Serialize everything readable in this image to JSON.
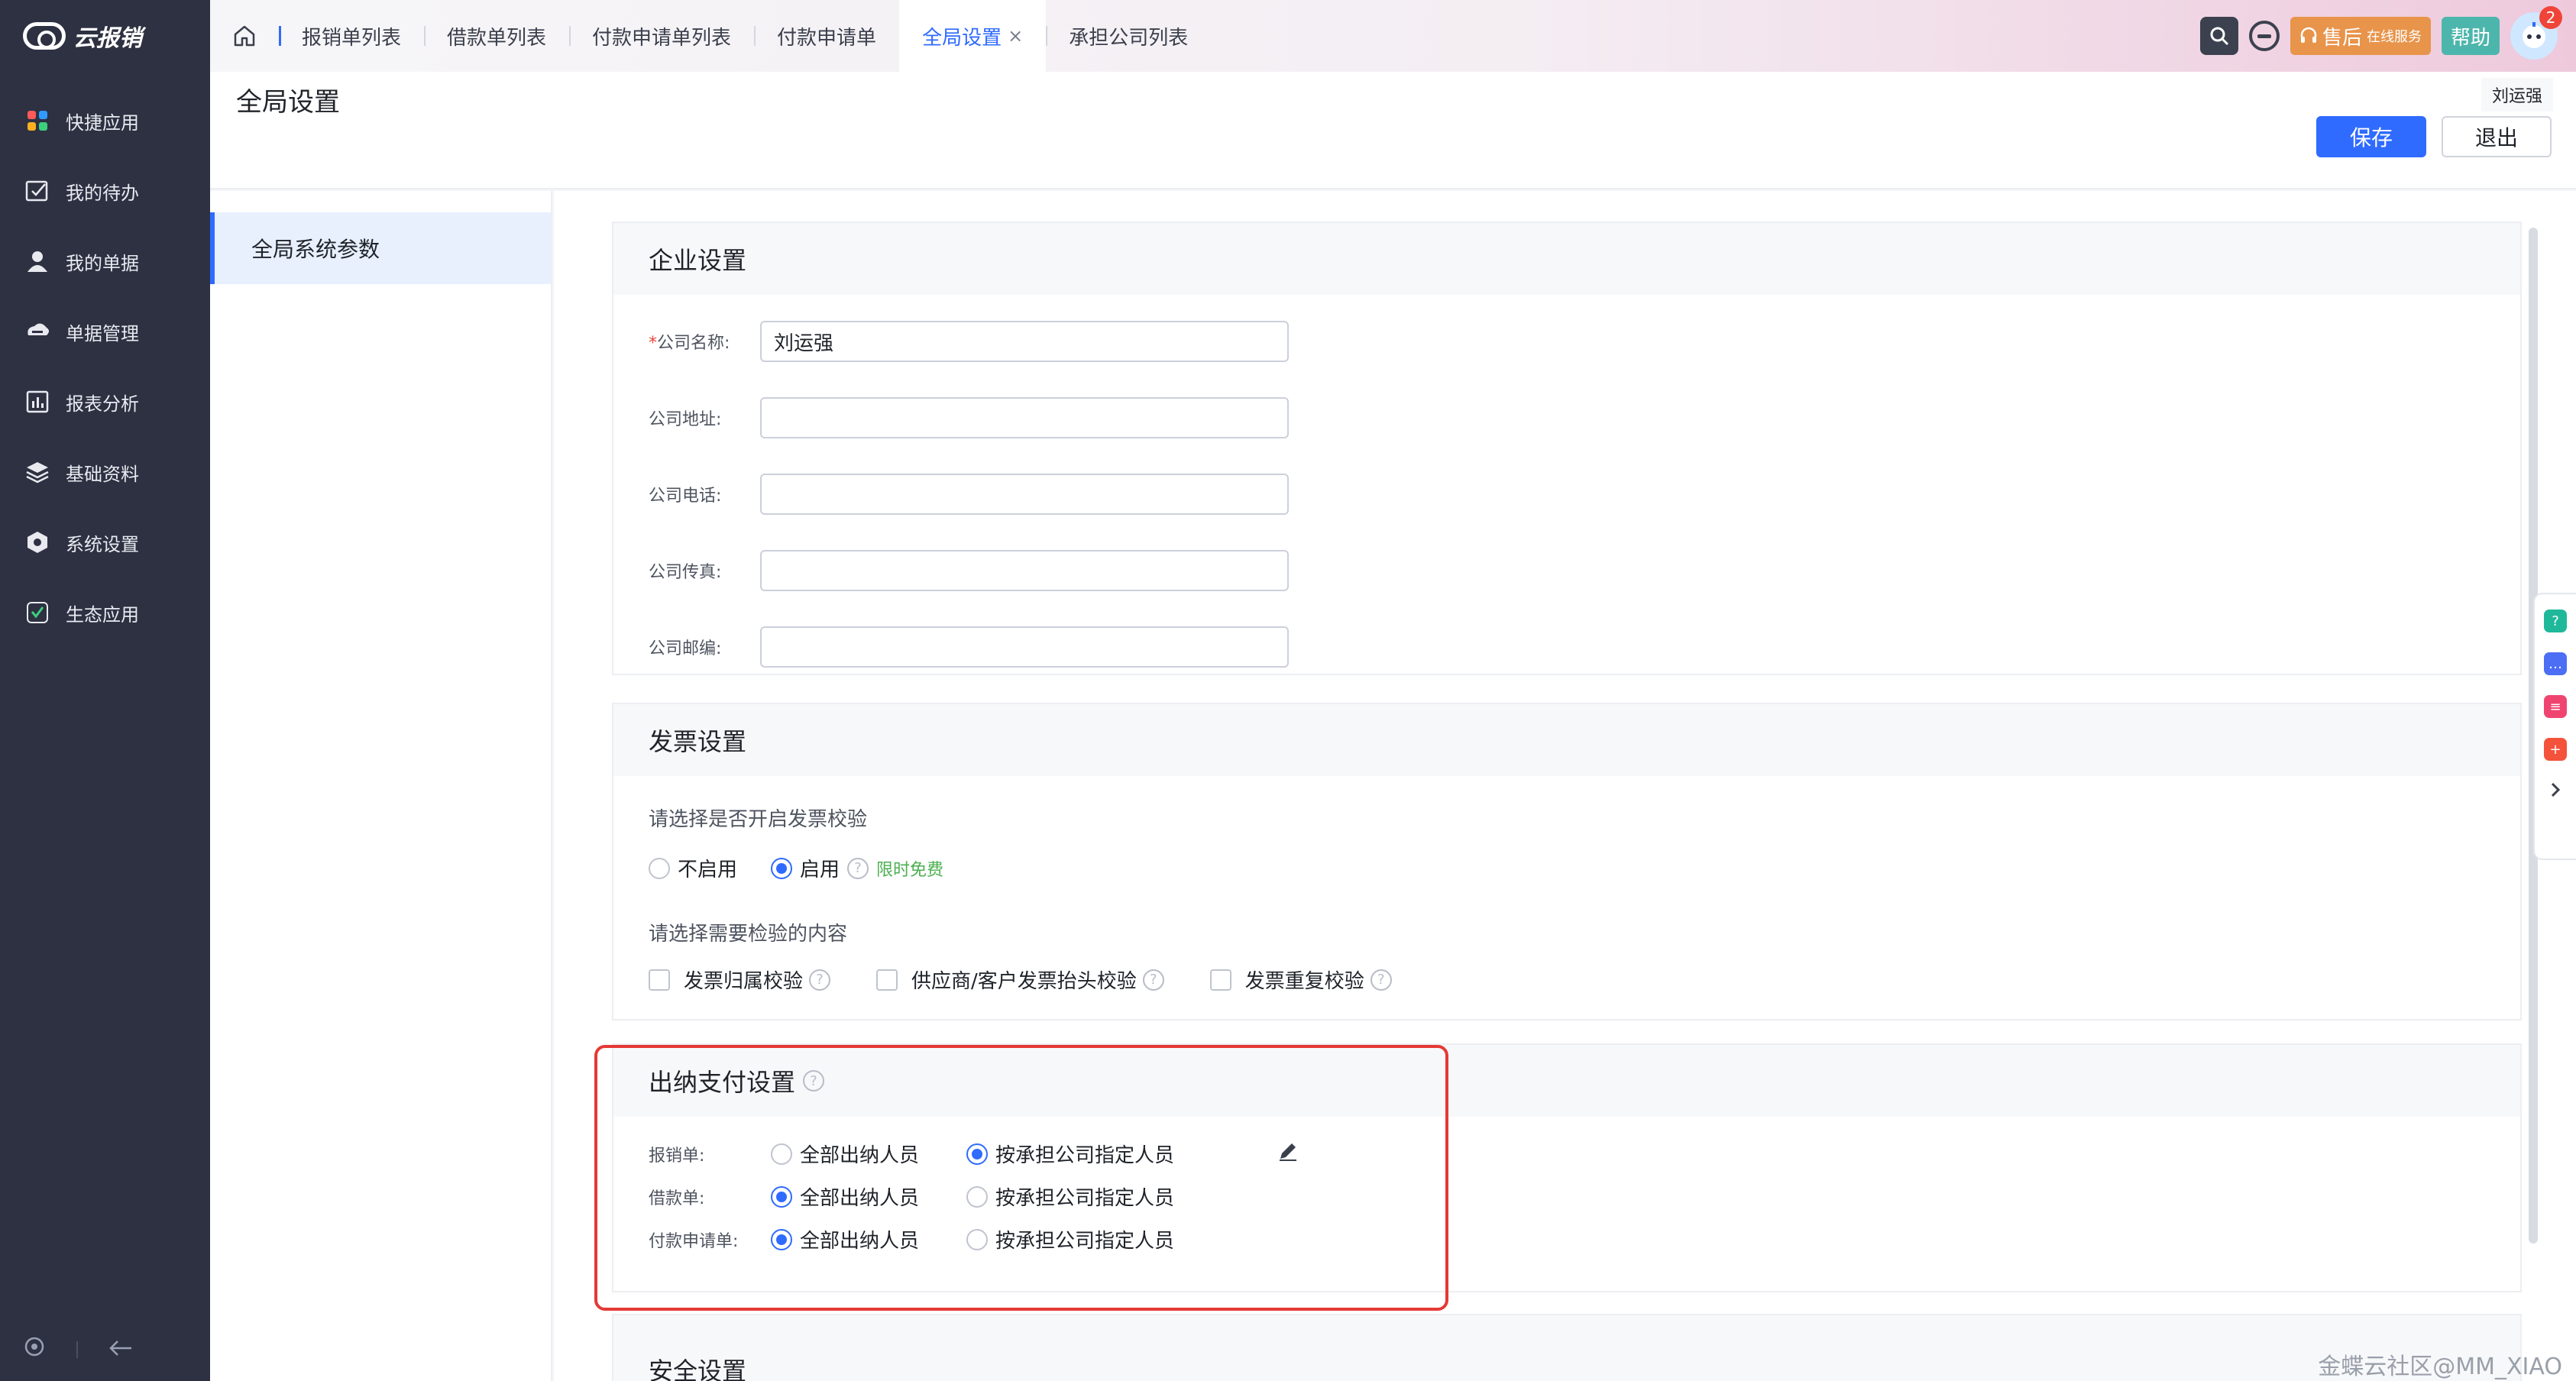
{
  "app": {
    "name": "云报销"
  },
  "sidebar": {
    "items": [
      {
        "label": "快捷应用",
        "icon": "apps-grid-icon"
      },
      {
        "label": "我的待办",
        "icon": "todo-check-icon"
      },
      {
        "label": "我的单据",
        "icon": "user-icon"
      },
      {
        "label": "单据管理",
        "icon": "document-manage-icon"
      },
      {
        "label": "报表分析",
        "icon": "report-chart-icon"
      },
      {
        "label": "基础资料",
        "icon": "layers-icon"
      },
      {
        "label": "系统设置",
        "icon": "hexagon-settings-icon"
      },
      {
        "label": "生态应用",
        "icon": "eco-app-icon"
      }
    ]
  },
  "tabs": [
    {
      "label": "报销单列表"
    },
    {
      "label": "借款单列表"
    },
    {
      "label": "付款申请单列表"
    },
    {
      "label": "付款申请单"
    },
    {
      "label": "全局设置",
      "active": true,
      "close": "×"
    },
    {
      "label": "承担公司列表"
    }
  ],
  "topbar": {
    "service_main": "售后",
    "service_sub": "在线服务",
    "help": "帮助",
    "notifications": "2"
  },
  "header": {
    "title": "全局设置",
    "user": "刘运强",
    "save": "保存",
    "exit": "退出"
  },
  "left_menu": {
    "item": "全局系统参数"
  },
  "company": {
    "title": "企业设置",
    "required_mark": "*",
    "fields": [
      {
        "label": "公司名称:",
        "value": "刘运强"
      },
      {
        "label": "公司地址:",
        "value": ""
      },
      {
        "label": "公司电话:",
        "value": ""
      },
      {
        "label": "公司传真:",
        "value": ""
      },
      {
        "label": "公司邮编:",
        "value": ""
      }
    ]
  },
  "invoice": {
    "title": "发票设置",
    "q1": "请选择是否开启发票校验",
    "off": "不启用",
    "on": "启用",
    "free": "限时免费",
    "q2": "请选择需要检验的内容",
    "checks": [
      "发票归属校验",
      "供应商/客户发票抬头校验",
      "发票重复校验"
    ]
  },
  "payment": {
    "title": "出纳支付设置",
    "opt_all": "全部出纳人员",
    "opt_company": "按承担公司指定人员",
    "rows": [
      {
        "label": "报销单:",
        "selected": "company"
      },
      {
        "label": "借款单:",
        "selected": "all"
      },
      {
        "label": "付款申请单:",
        "selected": "all"
      }
    ]
  },
  "security": {
    "title": "安全设置"
  },
  "watermark": "金蝶云社区@MM_XIAO",
  "colors": {
    "primary": "#2f6bff",
    "sidebar": "#2d3142",
    "highlight": "#e53935",
    "free": "#4caf50"
  }
}
